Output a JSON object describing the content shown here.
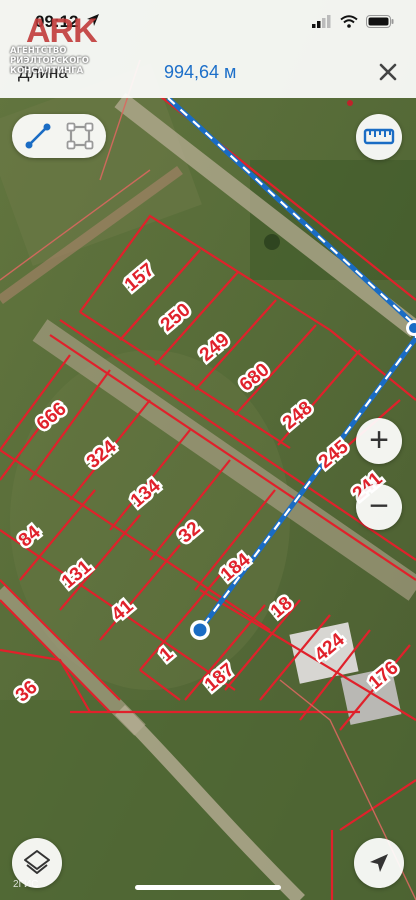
{
  "status_bar": {
    "time": "09:12"
  },
  "measure": {
    "label": "Длина",
    "value": "994,64 м"
  },
  "watermark": {
    "logo": "ARK",
    "lines": [
      "АГЕНТСТВО",
      "РИЭЛТОРСКОГО",
      "КОНСАЛТИНГА"
    ]
  },
  "zoom": {
    "in_label": "+",
    "out_label": "−"
  },
  "attribution": "2ГИС",
  "parcels": [
    "157",
    "250",
    "249",
    "680",
    "248",
    "245",
    "241",
    "666",
    "324",
    "134",
    "32",
    "184",
    "84",
    "131",
    "41",
    "18",
    "1",
    "187",
    "424",
    "176",
    "36"
  ],
  "colors": {
    "boundary": "#e0212b",
    "route": "#1a6cc4",
    "label_bg": "#ffffff"
  },
  "icons": [
    "location-arrow-icon",
    "cellular-signal-icon",
    "wifi-icon",
    "battery-icon",
    "close-icon",
    "line-tool-icon",
    "polygon-tool-icon",
    "ruler-icon",
    "layers-icon",
    "navigation-arrow-icon"
  ]
}
